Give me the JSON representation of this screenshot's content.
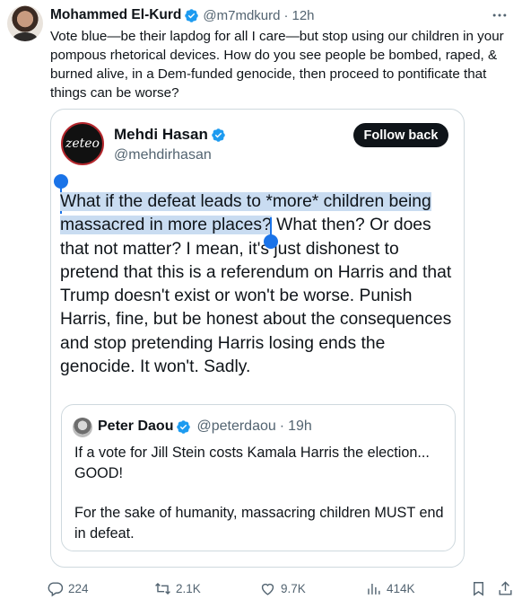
{
  "tweet": {
    "author_name": "Mohammed El-Kurd",
    "author_handle": "@m7mdkurd",
    "separator": "·",
    "time": "12h",
    "more_icon": "more-horizontal-icon",
    "text": "Vote blue—be their lapdog for all I care—but stop using our children in your pompous rhetorical devices. How do you see people be bombed, raped, & burned alive, in a Dem-funded genocide, then proceed to pontificate that things can be worse?"
  },
  "quote": {
    "avatar_text": "zeteo",
    "author_name": "Mehdi Hasan",
    "author_handle": "@mehdirhasan",
    "follow_label": "Follow back",
    "text_highlighted": "What if the defeat leads to *more* children being massacred in more places?",
    "text_rest": " What then? Or does that not matter? I mean, it's just dishonest to pretend that this is a referendum on Harris and that Trump doesn't exist or won't be worse. Punish Harris, fine, but be honest about the consequences and stop pretending Harris losing ends the genocide. It won't. Sadly.",
    "inner": {
      "author_name": "Peter Daou",
      "author_handle": "@peterdaou",
      "separator": "·",
      "time": "19h",
      "paragraph1": "If a vote for Jill Stein costs Kamala Harris the election... GOOD!",
      "paragraph2": "For the sake of humanity, massacring children MUST end in defeat."
    }
  },
  "actions": {
    "replies": "224",
    "reposts": "2.1K",
    "likes": "9.7K",
    "views": "414K"
  },
  "colors": {
    "verified": "#1d9bf0",
    "selection": "#c9dcf1",
    "selection_handle": "#1a73e8",
    "secondary_text": "#536471"
  }
}
